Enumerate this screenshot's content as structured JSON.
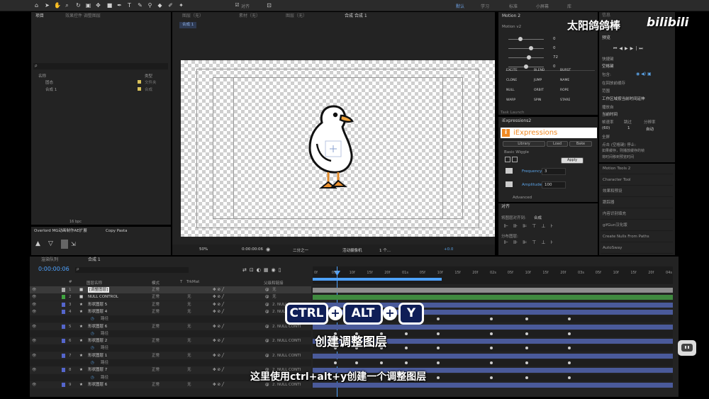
{
  "toolbar": {
    "workspaces": [
      "默认",
      "学习",
      "标准",
      "小屏幕",
      "库"
    ],
    "align_label": "对齐"
  },
  "watermark": {
    "channel": "太阳鸽鸽棒",
    "logo": "bilibili"
  },
  "project_panel": {
    "tab": "项目",
    "effect_controls_tab": "效果控件 调整图层",
    "search_placeholder": "ρ",
    "col_name": "名称",
    "col_type": "类型",
    "items": [
      {
        "name": "固态",
        "type": "文件夹",
        "color": "#d8c15a"
      },
      {
        "name": "合成 1",
        "type": "合成",
        "color": "#d8c15a"
      }
    ],
    "bit_depth": "16 bpc"
  },
  "lower_left": {
    "tab1": "Overlord MG动画制作AE扩展",
    "tab2": "Copy Pasta"
  },
  "viewer": {
    "tabs": [
      "图层（无）",
      "素材（无）",
      "图层（无）",
      "合成 合成 1"
    ],
    "comp_label": "合成 1",
    "zoom": "50%",
    "timecode": "0:00:00:06",
    "resolution": "二分之一",
    "camera": "活动摄像机",
    "views": "1 个...",
    "exposure": "+0.0"
  },
  "motion_panel": {
    "title": "Motion 2",
    "version": "Motion v2",
    "slider_values": [
      "0",
      "0",
      "72",
      "0"
    ],
    "buttons": [
      "EXCITE",
      "BLEND",
      "BURST",
      "CLONE",
      "JUMP",
      "NAME",
      "NULL",
      "ORBIT",
      "ROPE",
      "WARP",
      "SPIN",
      "STARE"
    ],
    "task_launch": "Task Launch"
  },
  "iexpressions": {
    "title": "iExpressions2",
    "logo": "iExpressions",
    "tabs": [
      "Library",
      "Load",
      "Bake"
    ],
    "section": "Basic Wiggle",
    "apply": "Apply",
    "frequency_label": "Frequency",
    "frequency_value": "3",
    "amplitude_label": "Amplitude",
    "amplitude_value": "100",
    "advanced": "Advanced"
  },
  "align_panel": {
    "title": "对齐",
    "align_to_label": "将图层对齐到:",
    "align_to_value": "合成",
    "distribute_label": "分布图层:"
  },
  "preview_panel": {
    "info_tab": "信息",
    "title": "预览",
    "shortcut_label": "快捷键",
    "shortcut_value": "空格键",
    "include_label": "包含:",
    "cache_before": "在回放前缓存",
    "range_label": "范围",
    "range_value": "工作区域按当前时间延伸",
    "play_from_label": "播放自",
    "play_from_value": "当前时间",
    "framerate_label": "帧速率",
    "skip_label": "跳过",
    "resolution_label": "分辨率",
    "framerate_value": "(60)",
    "skip_value": "1",
    "resolution_value": "自动",
    "fullscreen": "全屏",
    "stop_label": "点击 (空格键) 停止:",
    "stop_opt1": "如果缓存，则播放缓存的帧",
    "stop_opt2": "将时间移到预览时间"
  },
  "right_list": [
    "Motion Tools 2",
    "Character Tool",
    "效果和预设",
    "跟踪器",
    "内容识别填充",
    "gifGun汉化版",
    "Create Nulls From Paths",
    "AutoSway"
  ],
  "timeline": {
    "tab_render": "渲染队列",
    "tab_comp": "合成 1",
    "timecode": "0:00:00:06",
    "search_placeholder": "ρ",
    "columns": [
      "#",
      "图层名称",
      "模式",
      "T",
      "TrkMat",
      "父级和链接"
    ],
    "ruler": [
      "0f",
      "05f",
      "10f",
      "15f",
      "20f",
      "01s",
      "05f",
      "10f",
      "15f",
      "20f",
      "02s",
      "05f",
      "10f",
      "15f",
      "20f",
      "03s",
      "05f",
      "10f",
      "15f",
      "20f",
      "04s"
    ],
    "layers": [
      {
        "num": "1",
        "name": "[调整图层]",
        "mode": "正常",
        "trk": "",
        "parent": "无",
        "color": "#aaaaaa"
      },
      {
        "num": "2",
        "name": "NULL CONTROL",
        "mode": "正常",
        "trk": "无",
        "parent": "无",
        "color": "#3fa33f"
      },
      {
        "num": "3",
        "name": "形状图层 5",
        "mode": "正常",
        "trk": "无",
        "parent": "2. NULL CONTI",
        "color": "#5566cc"
      },
      {
        "num": "4",
        "name": "形状图层 4",
        "mode": "正常",
        "trk": "无",
        "parent": "2. NULL CONTI",
        "color": "#5566cc"
      },
      {
        "num": "",
        "name": "路径",
        "sub": true
      },
      {
        "num": "5",
        "name": "形状图层 6",
        "mode": "正常",
        "trk": "无",
        "parent": "2. NULL CONTI",
        "color": "#5566cc"
      },
      {
        "num": "",
        "name": "路径",
        "sub": true
      },
      {
        "num": "6",
        "name": "形状图层 2",
        "mode": "正常",
        "trk": "无",
        "parent": "2. NULL CONTI",
        "color": "#5566cc"
      },
      {
        "num": "",
        "name": "路径",
        "sub": true
      },
      {
        "num": "7",
        "name": "形状图层 1",
        "mode": "正常",
        "trk": "无",
        "parent": "2. NULL CONTI",
        "color": "#5566cc"
      },
      {
        "num": "",
        "name": "路径",
        "sub": true
      },
      {
        "num": "8",
        "name": "形状图层 7",
        "mode": "正常",
        "trk": "无",
        "parent": "2. NULL CONTI",
        "color": "#5566cc"
      },
      {
        "num": "",
        "name": "路径",
        "sub": true
      },
      {
        "num": "9",
        "name": "形状图层 6",
        "mode": "正常",
        "trk": "无",
        "parent": "2. NULL CONTI",
        "color": "#5566cc"
      }
    ]
  },
  "overlay": {
    "keys": [
      "CTRL",
      "ALT",
      "Y"
    ],
    "plus": "+",
    "title": "创建调整图层",
    "subtitle": "这里使用ctrl+alt+y创建一个调整图层"
  }
}
